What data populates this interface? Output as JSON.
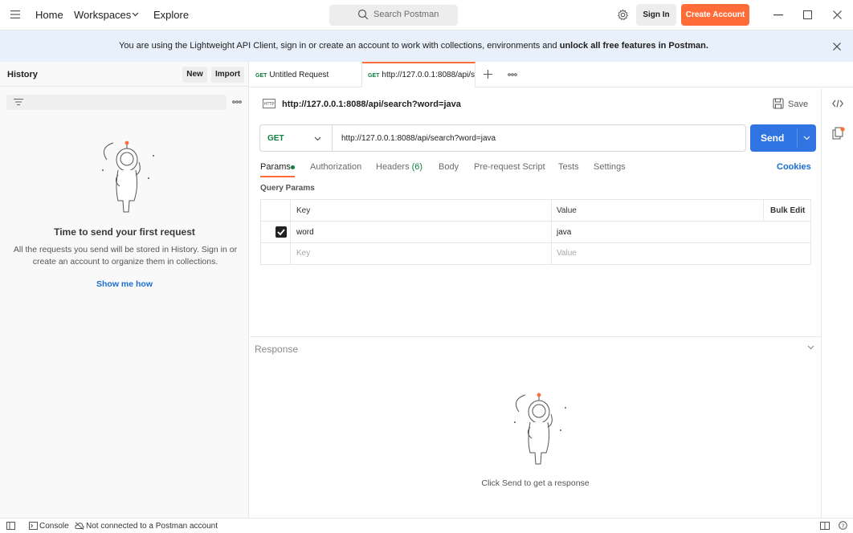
{
  "titlebar": {
    "nav": [
      "Home",
      "Workspaces",
      "Explore"
    ],
    "search_placeholder": "Search Postman",
    "signin_label": "Sign In",
    "create_account_label": "Create Account"
  },
  "banner": {
    "text_prefix": "You are using the Lightweight API Client, sign in or create an account to work with collections, environments and ",
    "text_bold": "unlock all free features in Postman."
  },
  "sidebar": {
    "title": "History",
    "new_label": "New",
    "import_label": "Import",
    "empty_title": "Time to send your first request",
    "empty_body": "All the requests you send will be stored in History. Sign in or create an account to organize them in collections.",
    "show_me_how": "Show me how"
  },
  "tabs": [
    {
      "method": "GET",
      "label": "Untitled Request",
      "active": false
    },
    {
      "method": "GET",
      "label": "http://127.0.0.1:8088/api/s",
      "active": true
    }
  ],
  "request": {
    "title": "http://127.0.0.1:8088/api/search?word=java",
    "save_label": "Save",
    "method": "GET",
    "url": "http://127.0.0.1:8088/api/search?word=java",
    "send_label": "Send",
    "req_tabs": [
      "Params",
      "Authorization",
      "Headers",
      "Body",
      "Pre-request Script",
      "Tests",
      "Settings"
    ],
    "headers_count": "(6)",
    "cookies_label": "Cookies",
    "query_params_label": "Query Params",
    "table": {
      "headers": [
        "Key",
        "Value",
        "Bulk Edit"
      ],
      "rows": [
        {
          "key": "word",
          "value": "java",
          "checked": true
        }
      ],
      "placeholder_key": "Key",
      "placeholder_value": "Value"
    }
  },
  "response": {
    "label": "Response",
    "empty_text": "Click Send to get a response"
  },
  "statusbar": {
    "console_label": "Console",
    "account_status": "Not connected to a Postman account"
  },
  "colors": {
    "accent": "#ff6c37",
    "send": "#2f74e0",
    "get": "#0b7f3e",
    "link": "#1a6cd6",
    "banner": "#e7f0fb"
  }
}
